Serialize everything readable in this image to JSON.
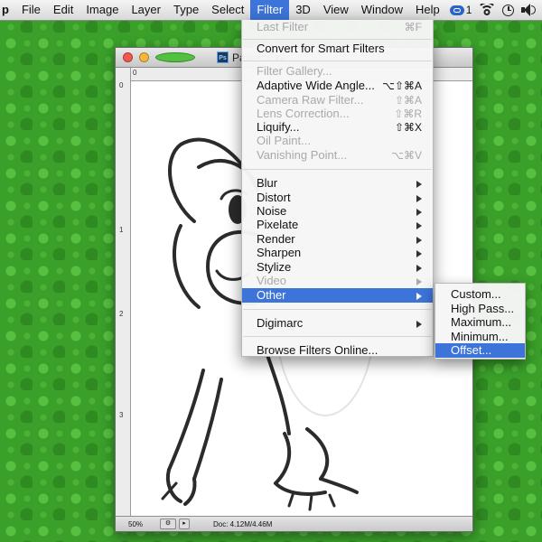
{
  "menubar": {
    "app": "p",
    "items": [
      "File",
      "Edit",
      "Image",
      "Layer",
      "Type",
      "Select",
      "Filter",
      "3D",
      "View",
      "Window",
      "Help"
    ],
    "active": "Filter",
    "status": {
      "cc_count": "1"
    }
  },
  "document": {
    "title": "PatternExa",
    "ruler_top": [
      "0"
    ],
    "ruler_left": [
      "0",
      "1",
      "2",
      "3"
    ],
    "zoom": "50%",
    "doc_info": "Doc: 4.12M/4.46M"
  },
  "filter_menu": {
    "items": [
      {
        "label": "Last Filter",
        "shortcut": "⌘F",
        "disabled": true
      },
      {
        "label": "Convert for Smart Filters"
      },
      {
        "label": "Filter Gallery...",
        "disabled": true
      },
      {
        "label": "Adaptive Wide Angle...",
        "shortcut": "⌥⇧⌘A"
      },
      {
        "label": "Camera Raw Filter...",
        "shortcut": "⇧⌘A",
        "disabled": true
      },
      {
        "label": "Lens Correction...",
        "shortcut": "⇧⌘R",
        "disabled": true
      },
      {
        "label": "Liquify...",
        "shortcut": "⇧⌘X"
      },
      {
        "label": "Oil Paint...",
        "disabled": true
      },
      {
        "label": "Vanishing Point...",
        "shortcut": "⌥⌘V",
        "disabled": true
      },
      {
        "label": "Blur",
        "submenu": true
      },
      {
        "label": "Distort",
        "submenu": true
      },
      {
        "label": "Noise",
        "submenu": true
      },
      {
        "label": "Pixelate",
        "submenu": true
      },
      {
        "label": "Render",
        "submenu": true
      },
      {
        "label": "Sharpen",
        "submenu": true
      },
      {
        "label": "Stylize",
        "submenu": true
      },
      {
        "label": "Video",
        "submenu": true,
        "disabled": true
      },
      {
        "label": "Other",
        "submenu": true,
        "selected": true
      },
      {
        "label": "Digimarc",
        "submenu": true
      },
      {
        "label": "Browse Filters Online..."
      }
    ]
  },
  "other_submenu": {
    "items": [
      {
        "label": "Custom..."
      },
      {
        "label": "High Pass..."
      },
      {
        "label": "Maximum..."
      },
      {
        "label": "Minimum..."
      },
      {
        "label": "Offset...",
        "selected": true
      }
    ]
  },
  "colors": {
    "selection": "#3c74d9",
    "desktop": "#3aa02a"
  }
}
